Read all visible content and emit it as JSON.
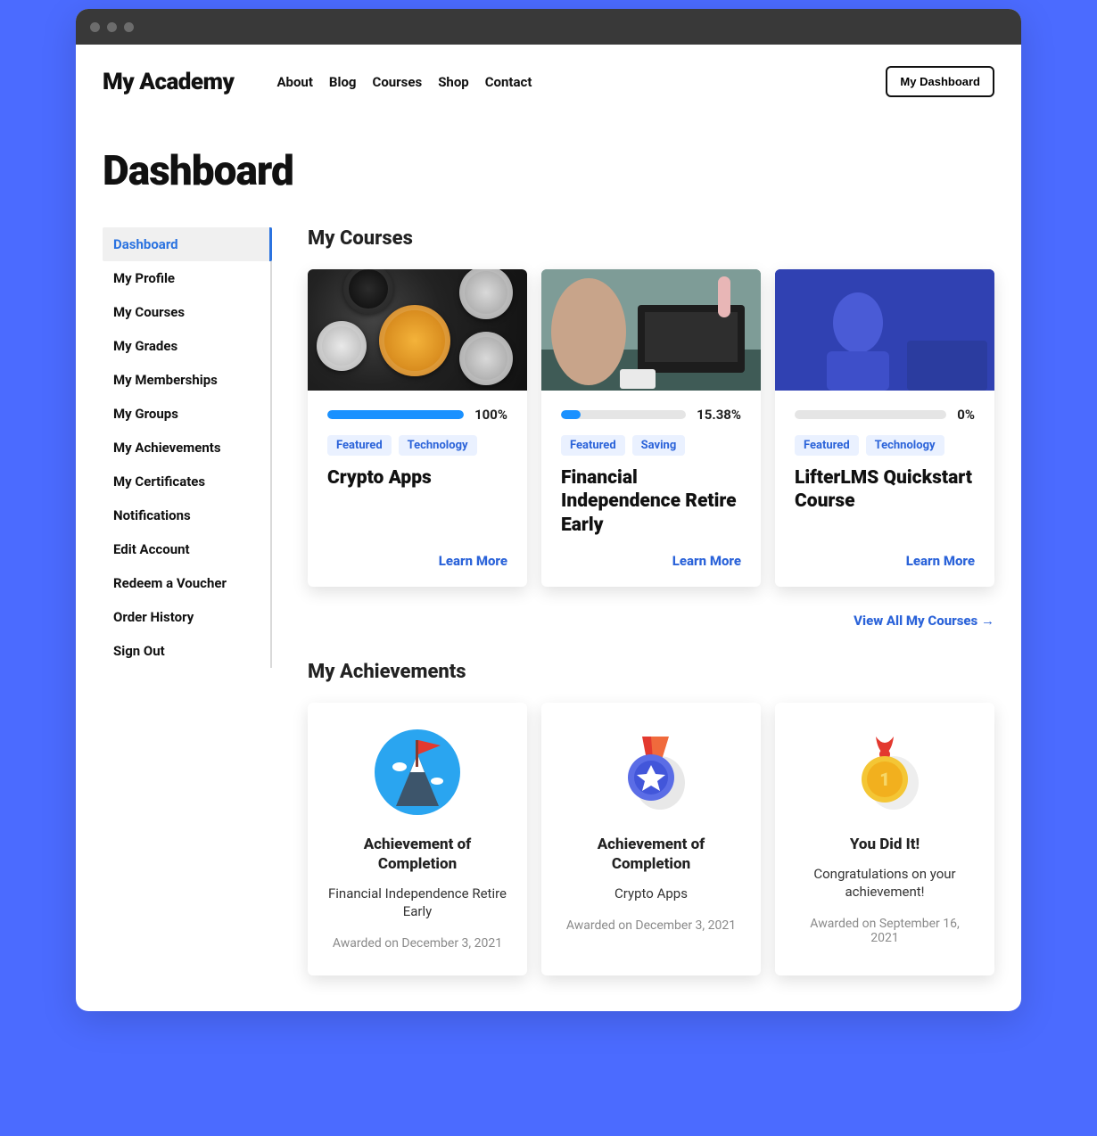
{
  "brand": "My Academy",
  "nav": [
    "About",
    "Blog",
    "Courses",
    "Shop",
    "Contact"
  ],
  "dashboard_button": "My Dashboard",
  "page_title": "Dashboard",
  "sidebar": [
    "Dashboard",
    "My Profile",
    "My Courses",
    "My Grades",
    "My Memberships",
    "My Groups",
    "My Achievements",
    "My Certificates",
    "Notifications",
    "Edit Account",
    "Redeem a Voucher",
    "Order History",
    "Sign Out"
  ],
  "sidebar_active_index": 0,
  "sections": {
    "courses_title": "My Courses",
    "achievements_title": "My Achievements"
  },
  "courses": [
    {
      "progress_pct": 100,
      "progress_label": "100%",
      "tags": [
        "Featured",
        "Technology"
      ],
      "title": "Crypto Apps",
      "cta": "Learn More"
    },
    {
      "progress_pct": 15.38,
      "progress_label": "15.38%",
      "tags": [
        "Featured",
        "Saving"
      ],
      "title": "Financial Independence Retire Early",
      "cta": "Learn More"
    },
    {
      "progress_pct": 0,
      "progress_label": "0%",
      "tags": [
        "Featured",
        "Technology"
      ],
      "title": "LifterLMS Quickstart Course",
      "cta": "Learn More"
    }
  ],
  "view_all": "View All My Courses  →",
  "achievements": [
    {
      "title": "Achievement of Completion",
      "subtitle": "Financial Independence Retire Early",
      "date": "Awarded on December 3, 2021"
    },
    {
      "title": "Achievement of Completion",
      "subtitle": "Crypto Apps",
      "date": "Awarded on December 3, 2021"
    },
    {
      "title": "You Did It!",
      "subtitle": "Congratulations on your achievement!",
      "date": "Awarded on September 16, 2021"
    }
  ]
}
